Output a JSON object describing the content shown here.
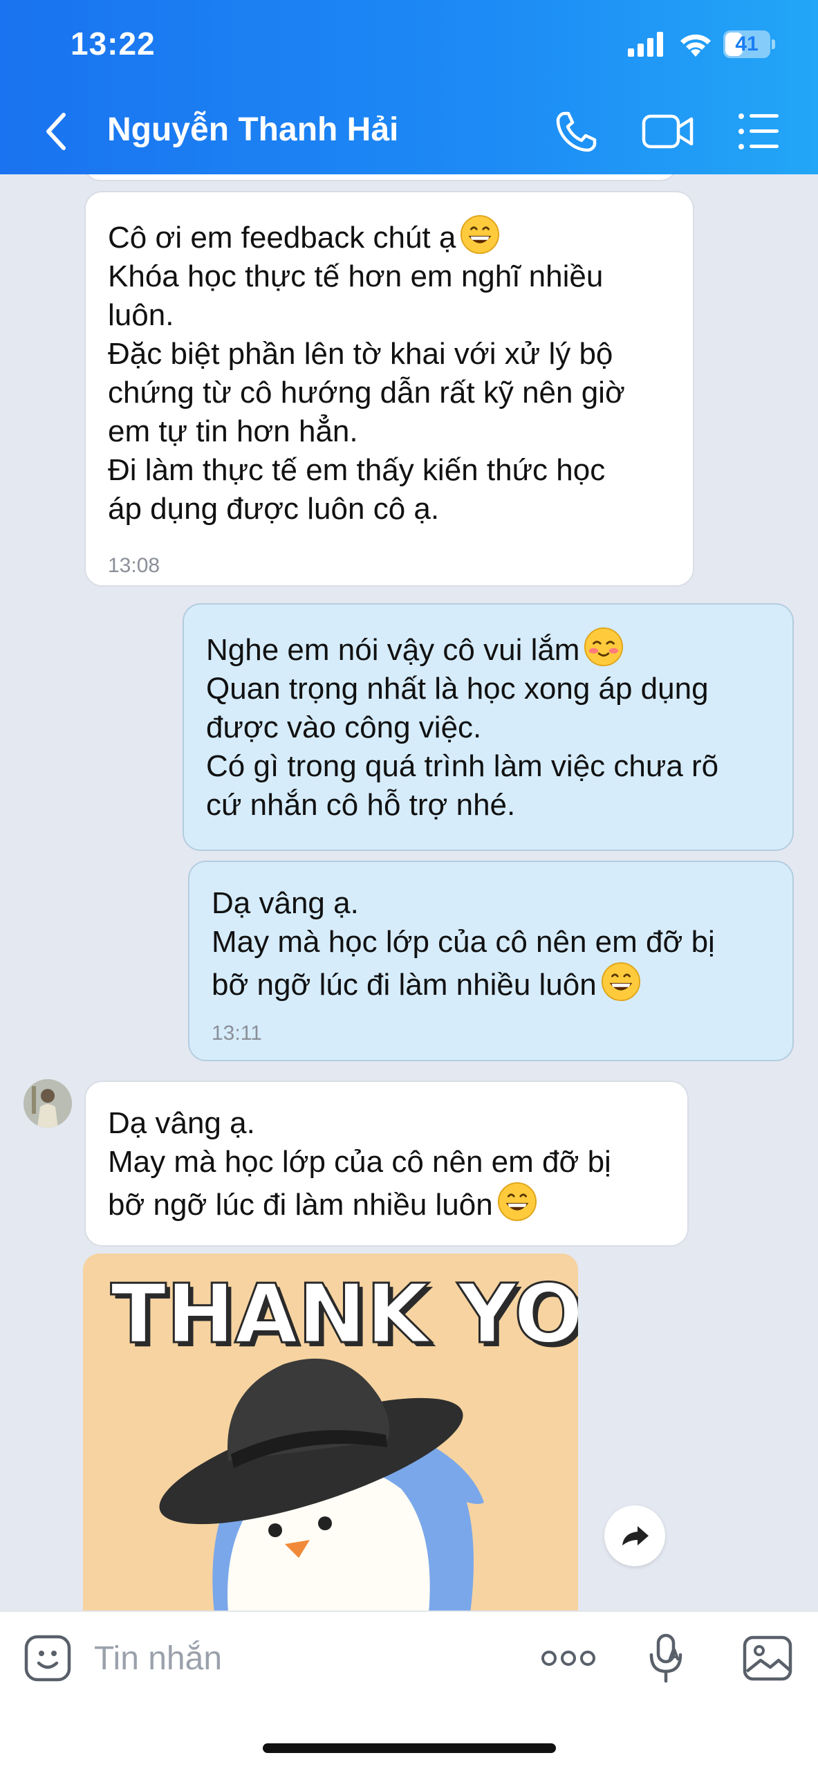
{
  "status_bar": {
    "time": "13:22",
    "battery": "41",
    "battery_level": 0.41
  },
  "header": {
    "contact_name": "Nguyễn Thanh Hải"
  },
  "messages": [
    {
      "direction": "incoming",
      "lines": [
        "Cô ơi em feedback chút ạ",
        "Khóa học thực tế hơn em nghĩ nhiều",
        "luôn.",
        "Đặc biệt phần lên tờ khai với xử lý bộ",
        "chứng từ cô hướng dẫn rất kỹ nên giờ",
        "em tự tin hơn hẳn.",
        "Đi làm thực tế em thấy kiến thức học",
        "áp dụng được luôn cô ạ."
      ],
      "emoji": "grin",
      "time": "13:08"
    },
    {
      "direction": "outgoing",
      "lines": [
        "Nghe em nói vậy cô vui lắm",
        "Quan trọng nhất là học xong áp dụng",
        "được vào công việc.",
        "Có gì trong quá trình làm việc chưa rõ",
        "cứ nhắn cô hỗ trợ nhé."
      ],
      "emoji": "blush"
    },
    {
      "direction": "outgoing",
      "lines": [
        "Dạ vâng ạ.",
        "May mà học lớp của cô nên em đỡ bị",
        "bỡ ngỡ lúc đi làm nhiều luôn"
      ],
      "emoji": "grin",
      "time": "13:11"
    },
    {
      "direction": "incoming",
      "lines": [
        "Dạ vâng ạ.",
        "May mà học lớp của cô nên em đỡ bị",
        "bỡ ngỡ lúc đi làm nhiều luôn"
      ],
      "emoji": "grin"
    }
  ],
  "sticker": {
    "text": "THANK YOU",
    "description_icon": "penguin-sticker"
  },
  "input_bar": {
    "placeholder": "Tin nhắn"
  },
  "icons": {
    "back": "chevron-left-icon",
    "call": "phone-icon",
    "video": "video-camera-icon",
    "menu": "list-menu-icon",
    "emoji": "sticker-smile-icon",
    "more": "more-dots-icon",
    "mic": "voice-mic-icon",
    "image": "image-icon",
    "forward": "share-arrow-icon"
  },
  "colors": {
    "header": "#1a7df3",
    "incoming_bubble": "#ffffff",
    "outgoing_bubble": "#d6ecfb",
    "chat_bg": "#e4e8f1"
  }
}
